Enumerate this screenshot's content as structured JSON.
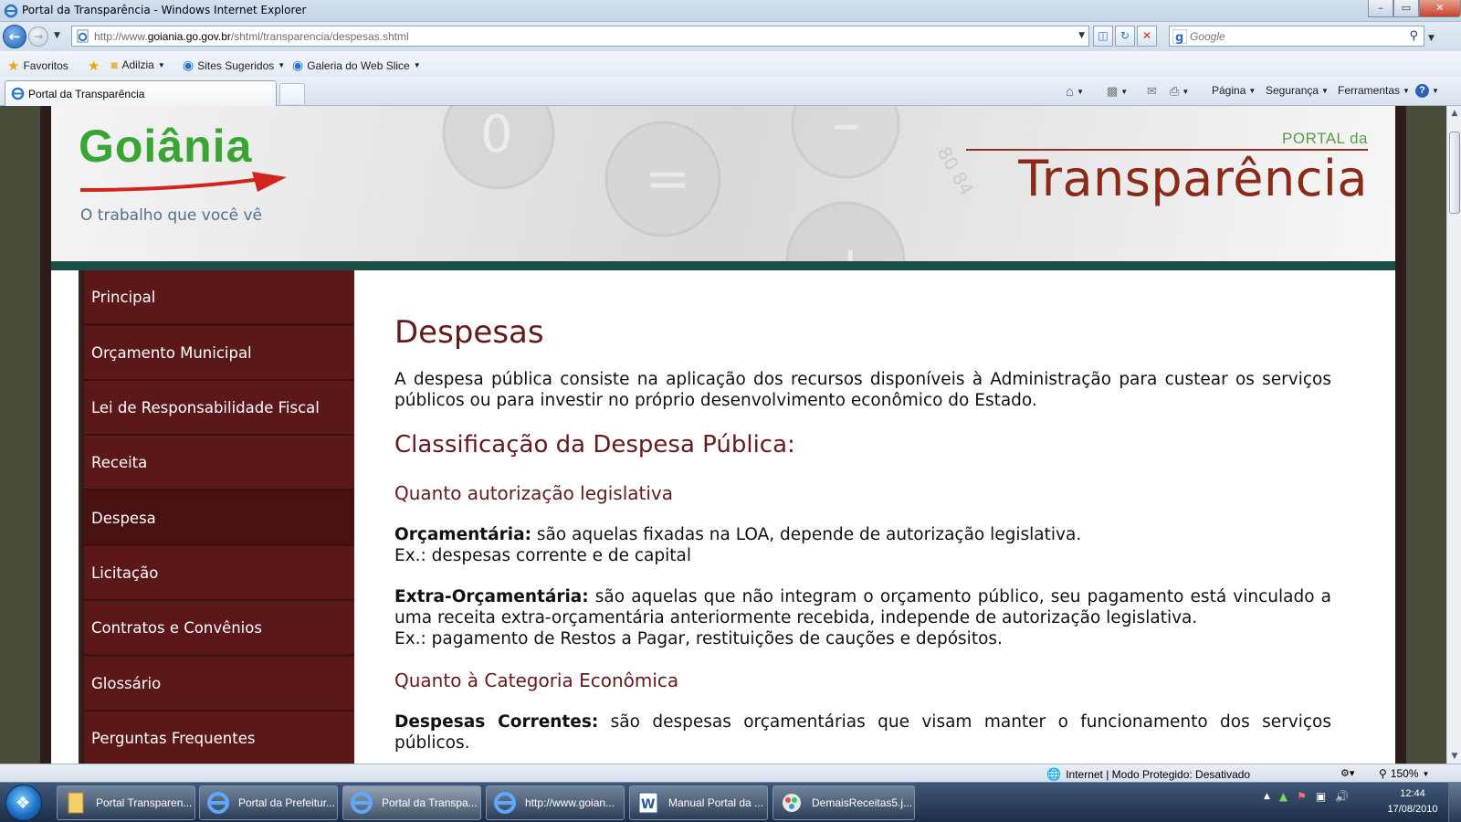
{
  "window": {
    "title": "Portal da Transparência - Windows Internet Explorer"
  },
  "address": {
    "url_prefix": "http://www.",
    "url_domain": "goiania.go.gov.br",
    "url_path": "/shtml/transparencia/despesas.shtml"
  },
  "search": {
    "placeholder": "Google"
  },
  "favorites": {
    "favorites_label": "Favoritos",
    "items": [
      "Adilzia",
      "Sites Sugeridos",
      "Galeria do Web Slice"
    ]
  },
  "tabs": [
    {
      "label": "Portal da Transparência"
    }
  ],
  "command_bar": {
    "page": "Página",
    "safety": "Segurança",
    "tools": "Ferramentas"
  },
  "site": {
    "logo_text": "Goiânia",
    "slogan": "O trabalho que você vê",
    "portal_small": "PORTAL da",
    "portal_big": "Transparência"
  },
  "sidebar": {
    "items": [
      {
        "label": "Principal"
      },
      {
        "label": "Orçamento Municipal"
      },
      {
        "label": "Lei de Responsabilidade Fiscal"
      },
      {
        "label": "Receita"
      },
      {
        "label": "Despesa"
      },
      {
        "label": "Licitação"
      },
      {
        "label": "Contratos e Convênios"
      },
      {
        "label": "Glossário"
      },
      {
        "label": "Perguntas Frequentes"
      }
    ],
    "active": "Despesa"
  },
  "content": {
    "title": "Despesas",
    "intro": "A despesa pública consiste na aplicação dos recursos disponíveis à Administração para custear os serviços públicos ou para investir no próprio desenvolvimento econômico do Estado.",
    "section_title": "Classificação da Despesa Pública:",
    "sub1": "Quanto autorização legislativa",
    "orc_term": "Orçamentária:",
    "orc_text": " são aquelas fixadas na LOA, depende de autorização legislativa.",
    "orc_ex": "Ex.: despesas corrente e de capital",
    "extra_term": "Extra-Orçamentária:",
    "extra_text": " são aquelas que não integram o orçamento público, seu pagamento está vinculado a uma receita extra-orçamentária anteriormente recebida, independe de autorização legislativa.",
    "extra_ex": "Ex.: pagamento de Restos a Pagar, restituições de cauções e depósitos.",
    "sub2": "Quanto à Categoria Econômica",
    "corr_term": "Despesas Correntes:",
    "corr_text": " são despesas orçamentárias que visam manter o funcionamento dos serviços públicos."
  },
  "status": {
    "zone": "Internet | Modo Protegido: Desativado",
    "zoom": "150%"
  },
  "taskbar": {
    "items": [
      {
        "label": "Portal Transparen..."
      },
      {
        "label": "Portal da Prefeitur..."
      },
      {
        "label": "Portal da Transpa..."
      },
      {
        "label": "http://www.goian..."
      },
      {
        "label": "Manual Portal da ..."
      },
      {
        "label": "DemaisReceitas5.j..."
      }
    ],
    "time": "12:44",
    "date": "17/08/2010"
  }
}
